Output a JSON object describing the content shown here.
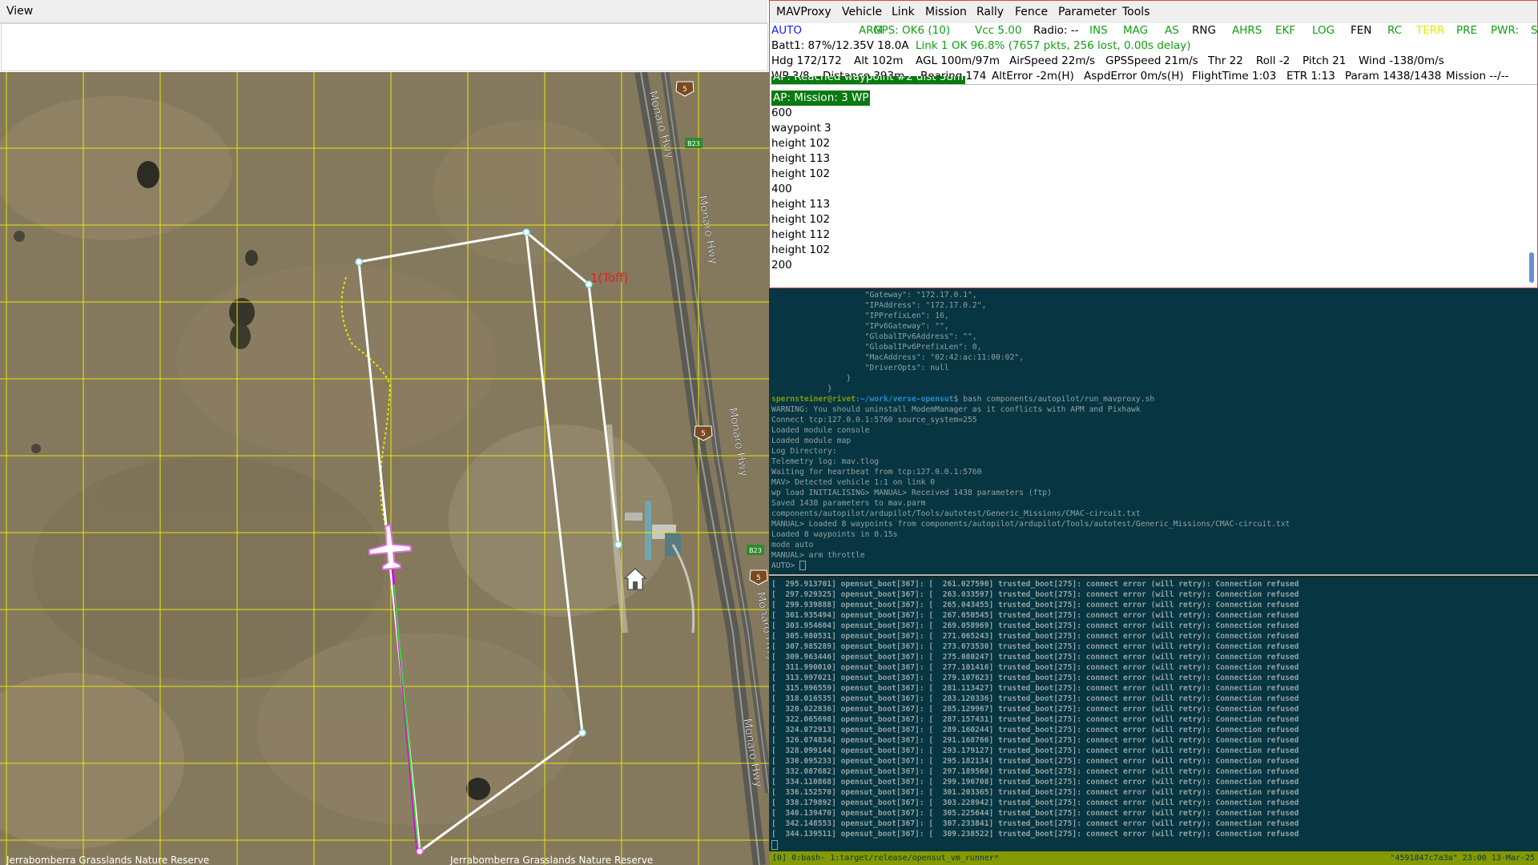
{
  "map_window": {
    "menu": "View",
    "labels": {
      "takeoff": "1(Toff)",
      "reserve_left": "Jerrabomberra Grasslands Nature Reserve",
      "reserve_right": "Jerrabomberra Grasslands Nature Reserve",
      "hwy1": "Monaro Hwy",
      "hwy2": "Monaro Hwy",
      "hwy3": "Monaro Hwy",
      "hwy4": "Monaro Hwy",
      "hwy5": "Monaro Hwy",
      "hwy6": "Monaro Hwy",
      "route_b23_a": "B23",
      "route_b23_b": "B23",
      "shield_a": "5",
      "shield_b": "5",
      "shield_c": "5"
    },
    "colors": {
      "grid": "#e8e800",
      "flight_path": "#ffffff",
      "aircraft_track": "#e000e0",
      "trail": "#e6e600",
      "takeoff_label": "#e02020"
    }
  },
  "console": {
    "menu": [
      "MAVProxy",
      "Vehicle",
      "Link",
      "Mission",
      "Rally",
      "Fence",
      "Parameter",
      "Tools"
    ],
    "row1": [
      {
        "text": "AUTO",
        "color": "#1a1aff"
      },
      {
        "text": "ARM",
        "color": "#10a010"
      },
      {
        "text": "GPS: OK6 (10)",
        "color": "#10a010"
      },
      {
        "text": "Vcc 5.00",
        "color": "#10a010"
      },
      {
        "text": "Radio: --",
        "color": "#000000"
      },
      {
        "text": "INS",
        "color": "#10a010"
      },
      {
        "text": "MAG",
        "color": "#10a010"
      },
      {
        "text": "AS",
        "color": "#10a010"
      },
      {
        "text": "RNG",
        "color": "#000000"
      },
      {
        "text": "AHRS",
        "color": "#10a010"
      },
      {
        "text": "EKF",
        "color": "#10a010"
      },
      {
        "text": "LOG",
        "color": "#10a010"
      },
      {
        "text": "FEN",
        "color": "#000000"
      },
      {
        "text": "RC",
        "color": "#10a010"
      },
      {
        "text": "TERR",
        "color": "#e8e800"
      },
      {
        "text": "PRE",
        "color": "#10a010"
      },
      {
        "text": "PWR:",
        "color": "#10a010"
      },
      {
        "text": "S",
        "color": "#10a010"
      }
    ],
    "row2": [
      {
        "text": "Batt1: 87%/12.35V 18.0A",
        "color": "#000000"
      },
      {
        "text": "Link 1 OK 96.8% (7657 pkts, 256 lost, 0.00s delay)",
        "color": "#10a010"
      }
    ],
    "row3": [
      "Hdg 172/172",
      "Alt 102m",
      "AGL 100m/97m",
      "AirSpeed 22m/s",
      "GPSSpeed 21m/s",
      "Thr 22",
      "Roll -2",
      "Pitch 21",
      "Wind -138/0m/s"
    ],
    "row4": [
      "WP 3/8",
      "Distance 393m",
      "Bearing 174",
      "AltError -2m(H)",
      "AspdError 0m/s(H)",
      "FlightTime 1:03",
      "ETR 1:13",
      "Param 1438/1438",
      "Mission --/--"
    ],
    "messages": [
      {
        "text": "AP: Reached waypoint #2 dist 38m",
        "hl": true
      },
      {
        "text": "AP: Mission: 3 WP",
        "hl": true
      },
      {
        "text": "600",
        "hl": false
      },
      {
        "text": "waypoint 3",
        "hl": false
      },
      {
        "text": "height 102",
        "hl": false
      },
      {
        "text": "height 113",
        "hl": false
      },
      {
        "text": "height 102",
        "hl": false
      },
      {
        "text": "400",
        "hl": false
      },
      {
        "text": "height 113",
        "hl": false
      },
      {
        "text": "height 102",
        "hl": false
      },
      {
        "text": "height 112",
        "hl": false
      },
      {
        "text": "height 102",
        "hl": false
      },
      {
        "text": "200",
        "hl": false
      }
    ]
  },
  "terminal_top": {
    "lines": [
      "                    \"Gateway\": \"172.17.0.1\",",
      "                    \"IPAddress\": \"172.17.0.2\",",
      "                    \"IPPrefixLen\": 16,",
      "                    \"IPv6Gateway\": \"\",",
      "                    \"GlobalIPv6Address\": \"\",",
      "                    \"GlobalIPv6PrefixLen\": 0,",
      "                    \"MacAddress\": \"02:42:ac:11:00:02\",",
      "                    \"DriverOpts\": null",
      "                }",
      "            }"
    ],
    "prompt_user": "spernsteiner@rivet",
    "prompt_path": ":~/work/verse-opensut",
    "prompt_cmd": "$ bash components/autopilot/run_mavproxy.sh",
    "output": [
      "WARNING: You should uninstall ModemManager as it conflicts with APM and Pixhawk",
      "Connect tcp:127.0.0.1:5760 source_system=255",
      "Loaded module console",
      "Loaded module map",
      "Log Directory:",
      "Telemetry log: mav.tlog",
      "Waiting for heartbeat from tcp:127.0.0.1:5760",
      "MAV> Detected vehicle 1:1 on link 0",
      "wp load INITIALISING> MANUAL> Received 1438 parameters (ftp)",
      "Saved 1438 parameters to mav.parm",
      "components/autopilot/ardupilot/Tools/autotest/Generic_Missions/CMAC-circuit.txt",
      "MANUAL> Loaded 8 waypoints from components/autopilot/ardupilot/Tools/autotest/Generic_Missions/CMAC-circuit.txt",
      "Loaded 8 waypoints in 0.15s",
      "mode auto",
      "MANUAL> arm throttle",
      "AUTO> "
    ]
  },
  "terminal_bottom": {
    "lines": [
      "[  295.913701] opensut_boot[367]: [  261.027590] trusted_boot[275]: connect error (will retry): Connection refused",
      "[  297.929325] opensut_boot[367]: [  263.033597] trusted_boot[275]: connect error (will retry): Connection refused",
      "[  299.939888] opensut_boot[367]: [  265.043455] trusted_boot[275]: connect error (will retry): Connection refused",
      "[  301.935494] opensut_boot[367]: [  267.050545] trusted_boot[275]: connect error (will retry): Connection refused",
      "[  303.954604] opensut_boot[367]: [  269.058969] trusted_boot[275]: connect error (will retry): Connection refused",
      "[  305.980531] opensut_boot[367]: [  271.065243] trusted_boot[275]: connect error (will retry): Connection refused",
      "[  307.985289] opensut_boot[367]: [  273.073530] trusted_boot[275]: connect error (will retry): Connection refused",
      "[  309.963446] opensut_boot[367]: [  275.080247] trusted_boot[275]: connect error (will retry): Connection refused",
      "[  311.990010] opensut_boot[367]: [  277.101416] trusted_boot[275]: connect error (will retry): Connection refused",
      "[  313.997021] opensut_boot[367]: [  279.107623] trusted_boot[275]: connect error (will retry): Connection refused",
      "[  315.996559] opensut_boot[367]: [  281.113427] trusted_boot[275]: connect error (will retry): Connection refused",
      "[  318.016535] opensut_boot[367]: [  283.120336] trusted_boot[275]: connect error (will retry): Connection refused",
      "[  320.022836] opensut_boot[367]: [  285.129967] trusted_boot[275]: connect error (will retry): Connection refused",
      "[  322.065698] opensut_boot[367]: [  287.157431] trusted_boot[275]: connect error (will retry): Connection refused",
      "[  324.072913] opensut_boot[367]: [  289.160244] trusted_boot[275]: connect error (will retry): Connection refused",
      "[  326.074834] opensut_boot[367]: [  291.168766] trusted_boot[275]: connect error (will retry): Connection refused",
      "[  328.099144] opensut_boot[367]: [  293.179127] trusted_boot[275]: connect error (will retry): Connection refused",
      "[  330.095233] opensut_boot[367]: [  295.182134] trusted_boot[275]: connect error (will retry): Connection refused",
      "[  332.087682] opensut_boot[367]: [  297.189560] trusted_boot[275]: connect error (will retry): Connection refused",
      "[  334.110868] opensut_boot[367]: [  299.196708] trusted_boot[275]: connect error (will retry): Connection refused",
      "[  336.152570] opensut_boot[367]: [  301.203365] trusted_boot[275]: connect error (will retry): Connection refused",
      "[  338.179892] opensut_boot[367]: [  303.228942] trusted_boot[275]: connect error (will retry): Connection refused",
      "[  340.139470] opensut_boot[367]: [  305.225644] trusted_boot[275]: connect error (will retry): Connection refused",
      "[  342.148553] opensut_boot[367]: [  307.233841] trusted_boot[275]: connect error (will retry): Connection refused",
      "[  344.139511] opensut_boot[367]: [  309.238522] trusted_boot[275]: connect error (will retry): Connection refused"
    ]
  },
  "tmux": {
    "left": "[0] 0:bash- 1:target/release/opensut_vm_runner*",
    "right": "\"4591847c7a3a\" 23:00 13-Mar-25"
  }
}
